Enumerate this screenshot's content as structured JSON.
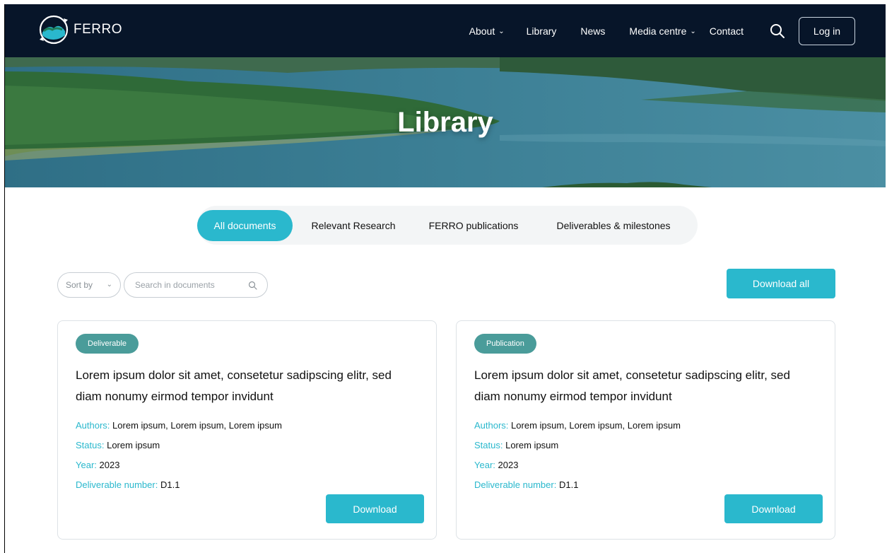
{
  "brand": {
    "name": "FERRO"
  },
  "nav": {
    "items": [
      {
        "label": "About",
        "has_dropdown": true
      },
      {
        "label": "Library",
        "has_dropdown": false
      },
      {
        "label": "News",
        "has_dropdown": false
      },
      {
        "label": "Media centre",
        "has_dropdown": true
      },
      {
        "label": "Contact",
        "has_dropdown": false
      }
    ],
    "search_icon": "search-icon",
    "login_label": "Log in"
  },
  "hero": {
    "title": "Library"
  },
  "tabs": [
    {
      "label": "All documents",
      "active": true
    },
    {
      "label": "Relevant Research",
      "active": false
    },
    {
      "label": "FERRO publications",
      "active": false
    },
    {
      "label": "Deliverables & milestones",
      "active": false
    }
  ],
  "filters": {
    "sort_label": "Sort by",
    "search_placeholder": "Search in documents",
    "download_all_label": "Download all"
  },
  "cards": [
    {
      "badge": "Deliverable",
      "title": "Lorem ipsum dolor sit amet, consetetur sadipscing elitr, sed diam nonumy eirmod tempor invidunt",
      "authors_key": "Authors:",
      "authors": "Lorem ipsum, Lorem ipsum, Lorem ipsum",
      "status_key": "Status:",
      "status": "Lorem ipsum",
      "year_key": "Year:",
      "year": "2023",
      "number_key": "Deliverable number:",
      "number": "D1.1",
      "download_label": "Download"
    },
    {
      "badge": "Publication",
      "title": "Lorem ipsum dolor sit amet, consetetur sadipscing elitr, sed diam nonumy eirmod tempor invidunt",
      "authors_key": "Authors:",
      "authors": "Lorem ipsum, Lorem ipsum, Lorem ipsum",
      "status_key": "Status:",
      "status": "Lorem ipsum",
      "year_key": "Year:",
      "year": "2023",
      "number_key": "Deliverable number:",
      "number": "D1.1",
      "download_label": "Download"
    }
  ],
  "colors": {
    "header_bg": "#071529",
    "accent": "#2ab8cd",
    "badge_bg": "#4a9c9a"
  }
}
